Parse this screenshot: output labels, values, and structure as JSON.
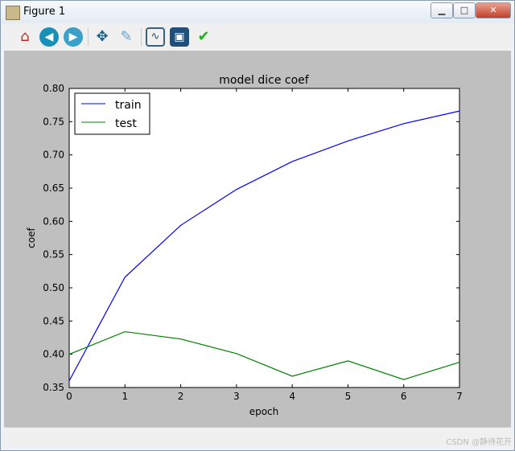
{
  "window": {
    "title": "Figure 1",
    "minimize_icon": "minimize-icon",
    "maximize_icon": "maximize-icon",
    "close_icon": "close-icon"
  },
  "toolbar": {
    "buttons": [
      {
        "name": "home",
        "icon": "home-icon"
      },
      {
        "name": "back",
        "icon": "arrow-left-icon"
      },
      {
        "name": "forward",
        "icon": "arrow-right-icon"
      },
      {
        "name": "pan",
        "icon": "move-icon"
      },
      {
        "name": "zoom",
        "icon": "zoom-rect-icon"
      },
      {
        "name": "subplots",
        "icon": "subplots-icon"
      },
      {
        "name": "save",
        "icon": "save-icon"
      },
      {
        "name": "edit",
        "icon": "checkmark-icon"
      }
    ]
  },
  "watermark": "CSDN @静待花开",
  "chart_data": {
    "type": "line",
    "title": "model dice coef",
    "xlabel": "epoch",
    "ylabel": "coef",
    "xlim": [
      0,
      7
    ],
    "ylim": [
      0.35,
      0.8
    ],
    "xticks": [
      "0",
      "1",
      "2",
      "3",
      "4",
      "5",
      "6",
      "7"
    ],
    "yticks": [
      "0.35",
      "0.40",
      "0.45",
      "0.50",
      "0.55",
      "0.60",
      "0.65",
      "0.70",
      "0.75",
      "0.80"
    ],
    "x": [
      0,
      1,
      2,
      3,
      4,
      5,
      6,
      7
    ],
    "legend": "top-left",
    "grid": false,
    "series": [
      {
        "name": "train",
        "color": "#0000ff",
        "values": [
          0.36,
          0.516,
          0.594,
          0.648,
          0.69,
          0.721,
          0.747,
          0.766
        ]
      },
      {
        "name": "test",
        "color": "#008000",
        "values": [
          0.4,
          0.434,
          0.423,
          0.401,
          0.367,
          0.39,
          0.362,
          0.388
        ]
      }
    ]
  }
}
